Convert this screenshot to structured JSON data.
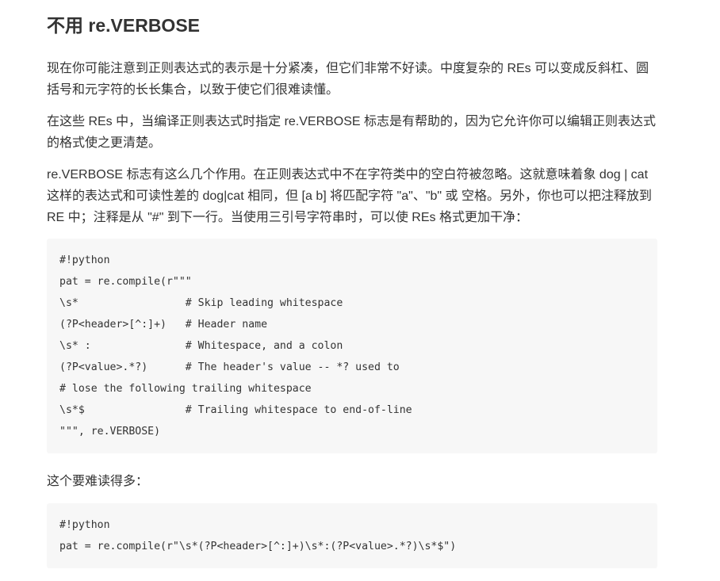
{
  "heading": "不用 re.VERBOSE",
  "paragraphs": [
    "现在你可能注意到正则表达式的表示是十分紧凑，但它们非常不好读。中度复杂的 REs 可以变成反斜杠、圆括号和元字符的长长集合，以致于使它们很难读懂。",
    "在这些 REs 中，当编译正则表达式时指定 re.VERBOSE 标志是有帮助的，因为它允许你可以编辑正则表达式的格式使之更清楚。",
    "re.VERBOSE 标志有这么几个作用。在正则表达式中不在字符类中的空白符被忽略。这就意味着象 dog | cat 这样的表达式和可读性差的 dog|cat 相同，但 [a b] 将匹配字符 \"a\"、\"b\" 或 空格。另外，你也可以把注释放到 RE 中；注释是从 \"#\" 到下一行。当使用三引号字符串时，可以使 REs 格式更加干净：",
    "这个要难读得多："
  ],
  "code_block_1": [
    "#!python",
    "pat = re.compile(r\"\"\"",
    "\\s*                 # Skip leading whitespace",
    "(?P<header>[^:]+)   # Header name",
    "\\s* :               # Whitespace, and a colon",
    "(?P<value>.*?)      # The header's value -- *? used to",
    "# lose the following trailing whitespace",
    "\\s*$                # Trailing whitespace to end-of-line",
    "\"\"\", re.VERBOSE)"
  ],
  "code_block_2": [
    "#!python",
    "pat = re.compile(r\"\\s*(?P<header>[^:]+)\\s*:(?P<value>.*?)\\s*$\")"
  ]
}
